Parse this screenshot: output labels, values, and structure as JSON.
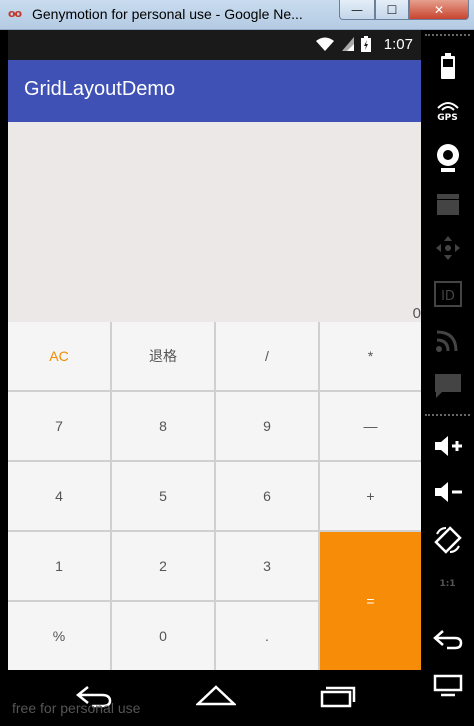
{
  "window": {
    "title": "Genymotion for personal use - Google Ne...",
    "app_icon": "oo",
    "min_label": "—",
    "max_label": "☐",
    "close_label": "✕"
  },
  "status_bar": {
    "wifi_icon": "wifi-icon",
    "signal_icon": "signal-icon",
    "battery_icon": "battery-icon",
    "time": "1:07"
  },
  "app_bar": {
    "title": "GridLayoutDemo",
    "color": "#3f51b5"
  },
  "display": {
    "value": "0"
  },
  "keypad": {
    "keys": {
      "ac": "AC",
      "backspace": "退格",
      "divide": "/",
      "multiply": "*",
      "seven": "7",
      "eight": "8",
      "nine": "9",
      "minus": "—",
      "four": "4",
      "five": "5",
      "six": "6",
      "plus": "+",
      "one": "1",
      "two": "2",
      "three": "3",
      "equals": "=",
      "percent": "%",
      "zero": "0",
      "dot": "."
    },
    "accent_color": "#f78c08"
  },
  "nav_bar": {
    "watermark": "free for personal use",
    "back_icon": "back-icon",
    "home_icon": "home-icon",
    "recents_icon": "recents-icon"
  },
  "toolbar": {
    "gps_label": "GPS",
    "pixel_label": "1:1"
  }
}
